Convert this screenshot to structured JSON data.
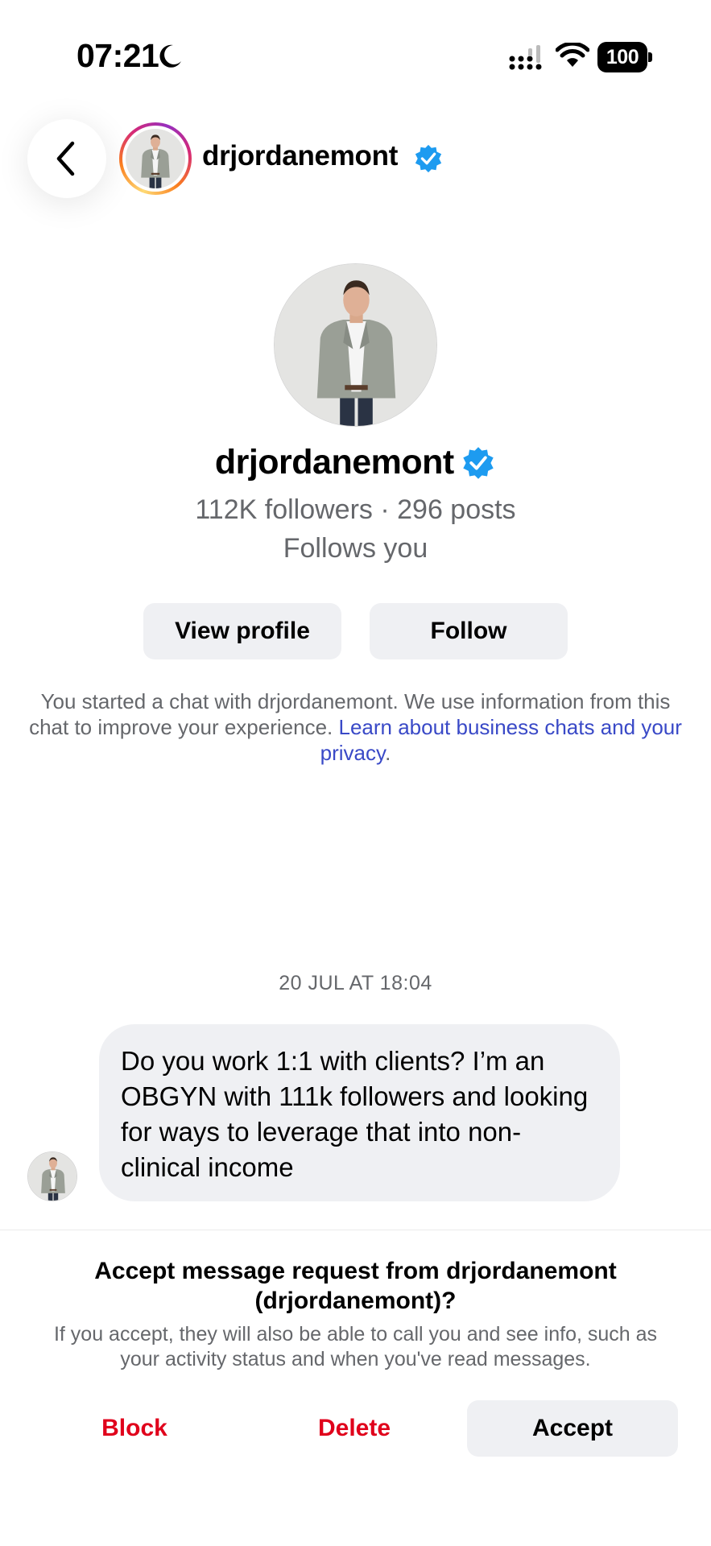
{
  "status_bar": {
    "time": "07:21",
    "battery": "100",
    "icons": [
      "moon-icon",
      "cellular-signal-icon",
      "wifi-icon",
      "battery-icon"
    ]
  },
  "header": {
    "back_icon": "chevron-left-icon",
    "username": "drjordanemont",
    "verified_icon": "verified-badge-icon"
  },
  "profile": {
    "username": "drjordanemont",
    "stats": "112K followers · 296 posts",
    "follows_you": "Follows you",
    "view_profile_label": "View profile",
    "follow_label": "Follow"
  },
  "disclaimer": {
    "text": "You started a chat with drjordanemont. We use information from this chat to improve your experience. ",
    "link_text": "Learn about business chats and your privacy",
    "suffix": "."
  },
  "conversation": {
    "timestamp": "20 JUL AT 18:04",
    "messages": [
      {
        "sender": "drjordanemont",
        "text": "Do you work 1:1 with clients? I’m an OBGYN with 111k followers and looking for ways to leverage that into non-clinical income"
      }
    ]
  },
  "message_request": {
    "title": "Accept message request from drjordanemont (drjordanemont)?",
    "body": "If you accept, they will also be able to call you and see info, such as your activity status and when you've read messages.",
    "block_label": "Block",
    "delete_label": "Delete",
    "accept_label": "Accept"
  },
  "colors": {
    "verified_blue": "#1d9bf0",
    "link_blue": "#3949c7",
    "destructive_red": "#e0001b",
    "secondary_text": "#65676b",
    "button_gray": "#eff0f3"
  }
}
